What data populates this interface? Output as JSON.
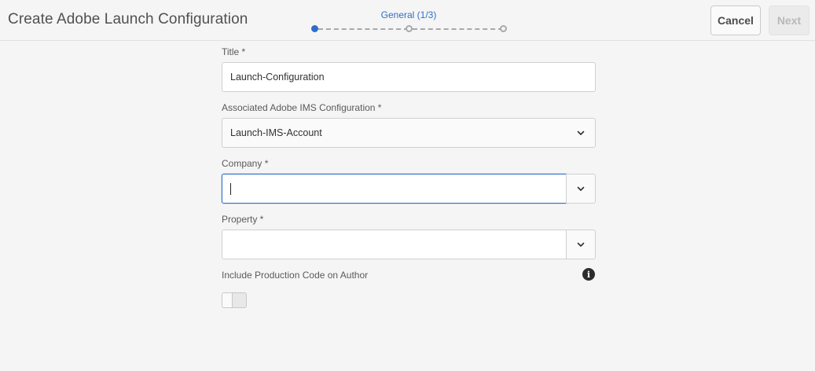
{
  "header": {
    "title": "Create Adobe Launch Configuration",
    "cancel_label": "Cancel",
    "next_label": "Next"
  },
  "wizard": {
    "step_label": "General (1/3)",
    "steps_total": 3,
    "current_step": 1
  },
  "form": {
    "title_label": "Title *",
    "title_value": "Launch-Configuration",
    "ims_label": "Associated Adobe IMS Configuration *",
    "ims_value": "Launch-IMS-Account",
    "company_label": "Company *",
    "company_value": "",
    "property_label": "Property *",
    "property_value": "",
    "include_prod_label": "Include Production Code on Author",
    "include_prod_enabled": false
  },
  "colors": {
    "accent": "#2d6ec8",
    "background": "#f5f5f5"
  },
  "icons": {
    "dropdown": "chevron-down-icon",
    "info": "info-icon"
  }
}
